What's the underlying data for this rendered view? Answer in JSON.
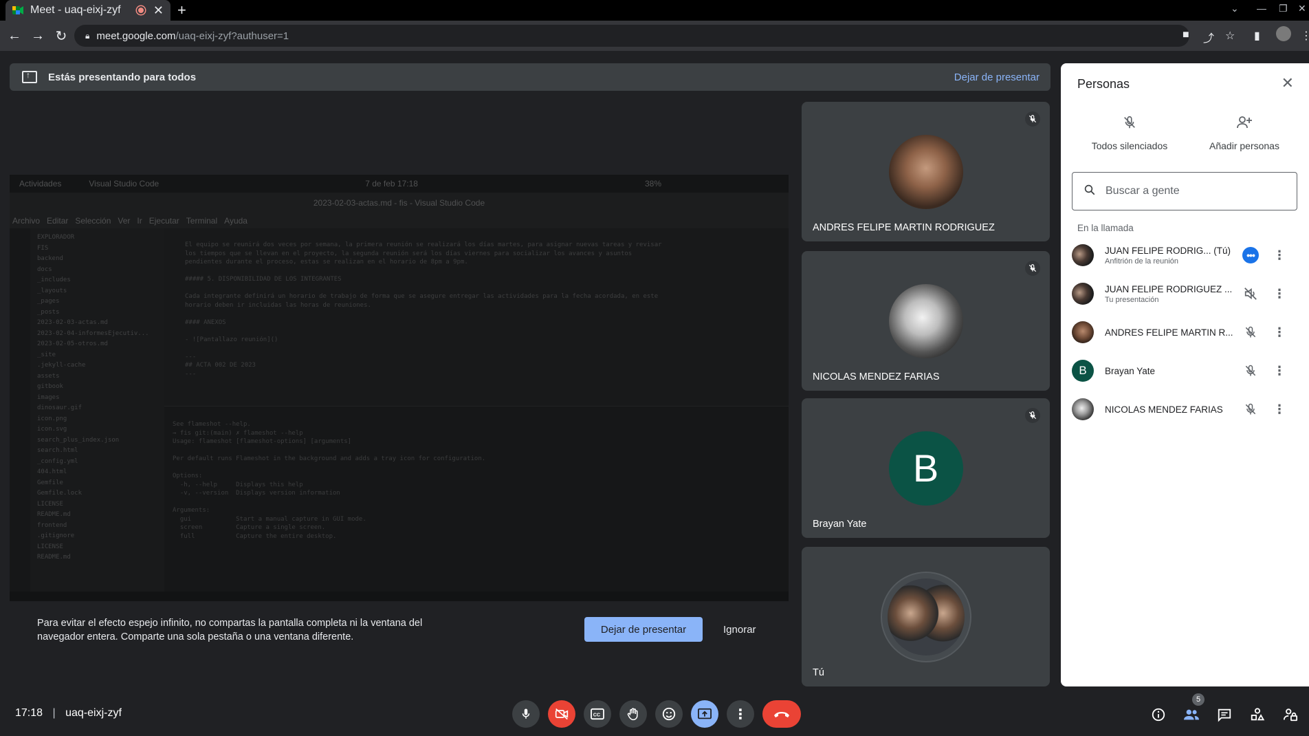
{
  "browser": {
    "tab_title": "Meet - uaq-eixj-zyf",
    "url_host": "meet.google.com",
    "url_path": "/uaq-eixj-zyf?authuser=1"
  },
  "present_bar": {
    "text": "Estás presentando para todos",
    "stop_label": "Dejar de presentar"
  },
  "shared_screen": {
    "top_bar": [
      "Actividades",
      "Visual Studio Code",
      "7 de feb 17:18",
      "38%"
    ],
    "window_title": "2023-02-03-actas.md - fis - Visual Studio Code",
    "menu": [
      "Archivo",
      "Editar",
      "Selección",
      "Ver",
      "Ir",
      "Ejecutar",
      "Terminal",
      "Ayuda"
    ],
    "explorer": [
      "EXPLORADOR",
      "FIS",
      "backend",
      "docs",
      "_includes",
      "_layouts",
      "_pages",
      "_posts",
      "2023-02-03-actas.md",
      "2023-02-04-informesEjecutiv...",
      "2023-02-05-otros.md",
      "_site",
      ".jekyll-cache",
      "assets",
      "gitbook",
      "images",
      "dinosaur.gif",
      "icon.png",
      "icon.svg",
      "search_plus_index.json",
      "search.html",
      "_config.yml",
      "404.html",
      "Gemfile",
      "Gemfile.lock",
      "LICENSE",
      "README.md",
      "frontend",
      ".gitignore",
      "LICENSE",
      "README.md"
    ],
    "editor_lines": [
      "El equipo se reunirá dos veces por semana, la primera reunión se realizará los días martes, para asignar nuevas tareas y revisar",
      "los tiempos que se llevan en el proyecto, la segunda reunión será los días viernes para socializar los avances y asuntos",
      "pendientes durante el proceso, estas se realizan en el horario de 8pm a 9pm.",
      "",
      "##### 5. DISPONIBILIDAD DE LOS INTEGRANTES",
      "",
      "Cada integrante definirá un horario de trabajo de forma que se asegure entregar las actividades para la fecha acordada, en este",
      "horario deben ir incluidas las horas de reuniones.",
      "",
      "#### ANEXOS",
      "",
      "- ![Pantallazo reunión]()",
      "",
      "---",
      "## ACTA 002 DE 2023",
      "---"
    ],
    "terminal_lines": [
      "See flameshot --help.",
      "→ fis git:(main) ✗ flameshot --help",
      "Usage: flameshot [flameshot-options] [arguments]",
      "",
      "Per default runs Flameshot in the background and adds a tray icon for configuration.",
      "",
      "Options:",
      "  -h, --help     Displays this help",
      "  -v, --version  Displays version information",
      "",
      "Arguments:",
      "  gui            Start a manual capture in GUI mode.",
      "  screen         Capture a single screen.",
      "  full           Capture the entire desktop."
    ]
  },
  "mirror_warning": {
    "text": "Para evitar el efecto espejo infinito, no compartas la pantalla completa ni la ventana del navegador entera. Comparte una sola pestaña o una ventana diferente.",
    "stop_label": "Dejar de presentar",
    "ignore_label": "Ignorar"
  },
  "tiles": [
    {
      "name": "ANDRES FELIPE MARTIN RODRIGUEZ"
    },
    {
      "name": "NICOLAS MENDEZ FARIAS"
    },
    {
      "name": "Brayan Yate",
      "initial": "B"
    },
    {
      "name": "Tú"
    }
  ],
  "people_panel": {
    "title": "Personas",
    "mute_all": "Todos silenciados",
    "add_people": "Añadir personas",
    "search_placeholder": "Buscar a gente",
    "in_call_label": "En la llamada",
    "participants": [
      {
        "name": "JUAN FELIPE RODRIG...",
        "tag": "(Tú)",
        "sub": "Anfitrión de la reunión"
      },
      {
        "name": "JUAN FELIPE RODRIGUEZ ...",
        "sub": "Tu presentación"
      },
      {
        "name": "ANDRES FELIPE MARTIN R..."
      },
      {
        "name": "Brayan Yate",
        "initial": "B"
      },
      {
        "name": "NICOLAS MENDEZ FARIAS"
      }
    ]
  },
  "bottom_bar": {
    "time": "17:18",
    "meeting_code": "uaq-eixj-zyf",
    "participant_count": "5"
  },
  "colors": {
    "accent_blue": "#8ab4f8",
    "danger_red": "#ea4335",
    "brayan_avatar": "#0b5345"
  }
}
